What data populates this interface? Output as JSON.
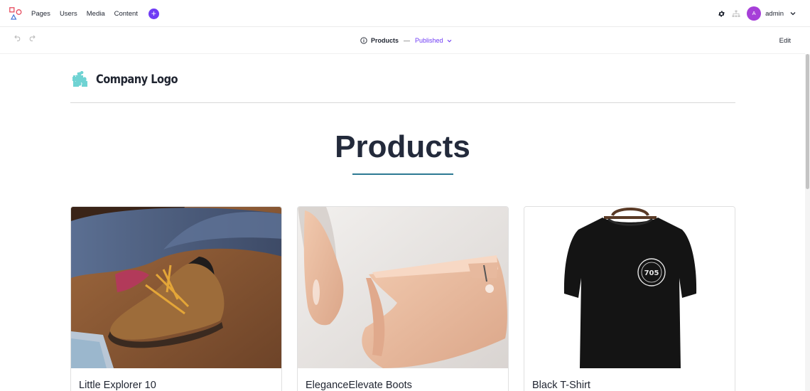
{
  "topbar": {
    "nav": [
      "Pages",
      "Users",
      "Media",
      "Content"
    ],
    "add_label": "+",
    "user": {
      "initial": "A",
      "name": "admin"
    }
  },
  "subbar": {
    "page_name": "Products",
    "separator": "—",
    "status": "Published",
    "edit_label": "Edit"
  },
  "site": {
    "logo_text": "Company Logo",
    "heading": "Products"
  },
  "products": [
    {
      "name": "Little Explorer 10",
      "image": "brown-boot-photo"
    },
    {
      "name": "EleganceElevate Boots",
      "image": "pink-heel-boot-photo"
    },
    {
      "name": "Black T-Shirt",
      "image": "black-tshirt-photo",
      "print": "705"
    }
  ],
  "colors": {
    "accent": "#6f3bf5",
    "avatar": "#a63fd8",
    "rule": "#2c7a93",
    "logo_icon": "#6fd3d3"
  }
}
